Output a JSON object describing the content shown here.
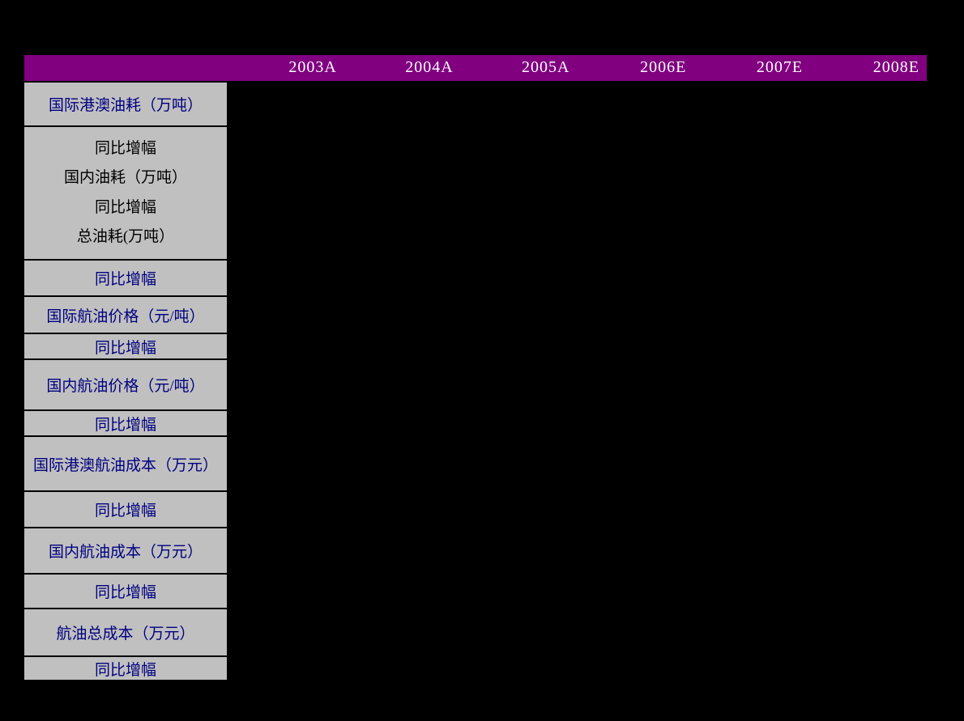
{
  "table": {
    "header": {
      "years": [
        "2003A",
        "2004A",
        "2005A",
        "2006E",
        "2007E",
        "2008E"
      ]
    },
    "row_labels": [
      {
        "label": "国际港澳油耗（万吨）"
      },
      {
        "lines": [
          "同比增幅",
          "国内油耗（万吨）",
          "同比增幅",
          "总油耗(万吨）"
        ]
      },
      {
        "label": "同比增幅"
      },
      {
        "label": "国际航油价格（元/吨）"
      },
      {
        "label": "同比增幅"
      },
      {
        "label": "国内航油价格（元/吨）"
      },
      {
        "label": "同比增幅"
      },
      {
        "label": "国际港澳航油成本（万元）"
      },
      {
        "label": "同比增幅"
      },
      {
        "label": "国内航油成本（万元）"
      },
      {
        "label": "同比增幅"
      },
      {
        "label": "航油总成本（万元）"
      },
      {
        "label": "同比增幅"
      }
    ],
    "data_cells_visible_values": [],
    "colors": {
      "page_background": "#000000",
      "header_background": "#800080",
      "header_text": "#ffffff",
      "label_background": "#c0c0c0",
      "label_text": "#000080",
      "label_group_text": "#000000",
      "cell_border": "#000000"
    }
  }
}
